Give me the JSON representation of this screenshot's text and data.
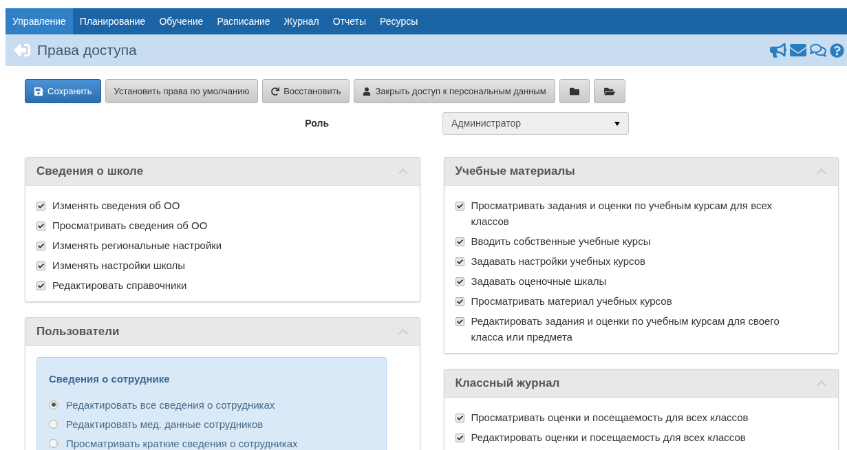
{
  "nav": [
    {
      "label": "Управление",
      "selected": true
    },
    {
      "label": "Планирование",
      "selected": false
    },
    {
      "label": "Обучение",
      "selected": false
    },
    {
      "label": "Расписание",
      "selected": false
    },
    {
      "label": "Журнал",
      "selected": false
    },
    {
      "label": "Отчеты",
      "selected": false
    },
    {
      "label": "Ресурсы",
      "selected": false
    }
  ],
  "header": {
    "title": "Права доступа"
  },
  "toolbar": [
    {
      "kind": "save",
      "label": "Сохранить"
    },
    {
      "kind": "plain",
      "label": "Установить права по умолчанию"
    },
    {
      "kind": "restore",
      "label": "Восстановить"
    },
    {
      "kind": "user",
      "label": "Закрыть доступ к персональным данным"
    },
    {
      "kind": "folder"
    },
    {
      "kind": "folderopen"
    }
  ],
  "role": {
    "label": "Роль",
    "value": "Администратор"
  },
  "columns": [
    [
      {
        "title": "Сведения о школе",
        "expanded": true,
        "items": [
          {
            "label": "Изменять сведения об ОО",
            "checked": true
          },
          {
            "label": "Просматривать сведения об ОО",
            "checked": true
          },
          {
            "label": "Изменять региональные настройки",
            "checked": true
          },
          {
            "label": "Изменять настройки школы",
            "checked": true
          },
          {
            "label": "Редактировать справочники",
            "checked": true
          }
        ]
      },
      {
        "title": "Пользователи",
        "expanded": true,
        "group": {
          "title": "Сведения о сотруднике",
          "options": [
            {
              "label": "Редактировать все сведения о сотрудниках",
              "selected": true
            },
            {
              "label": "Редактировать мед. данные сотрудников",
              "selected": false
            },
            {
              "label": "Просматривать краткие сведения о сотрудниках",
              "selected": false
            }
          ]
        }
      }
    ],
    [
      {
        "title": "Учебные материалы",
        "expanded": true,
        "items": [
          {
            "label": "Просматривать задания и оценки по учебным курсам для всех классов",
            "checked": true
          },
          {
            "label": "Вводить собственные учебные курсы",
            "checked": true
          },
          {
            "label": "Задавать настройки учебных курсов",
            "checked": true
          },
          {
            "label": "Задавать оценочные шкалы",
            "checked": true
          },
          {
            "label": "Просматривать материал учебных курсов",
            "checked": true
          },
          {
            "label": "Редактировать задания и оценки по учебным курсам для своего класса или предмета",
            "checked": true
          }
        ]
      },
      {
        "title": "Классный журнал",
        "expanded": true,
        "items": [
          {
            "label": "Просматривать оценки и посещаемость для всех классов",
            "checked": true
          },
          {
            "label": "Редактировать оценки и посещаемость для всех классов",
            "checked": true
          }
        ]
      }
    ]
  ]
}
